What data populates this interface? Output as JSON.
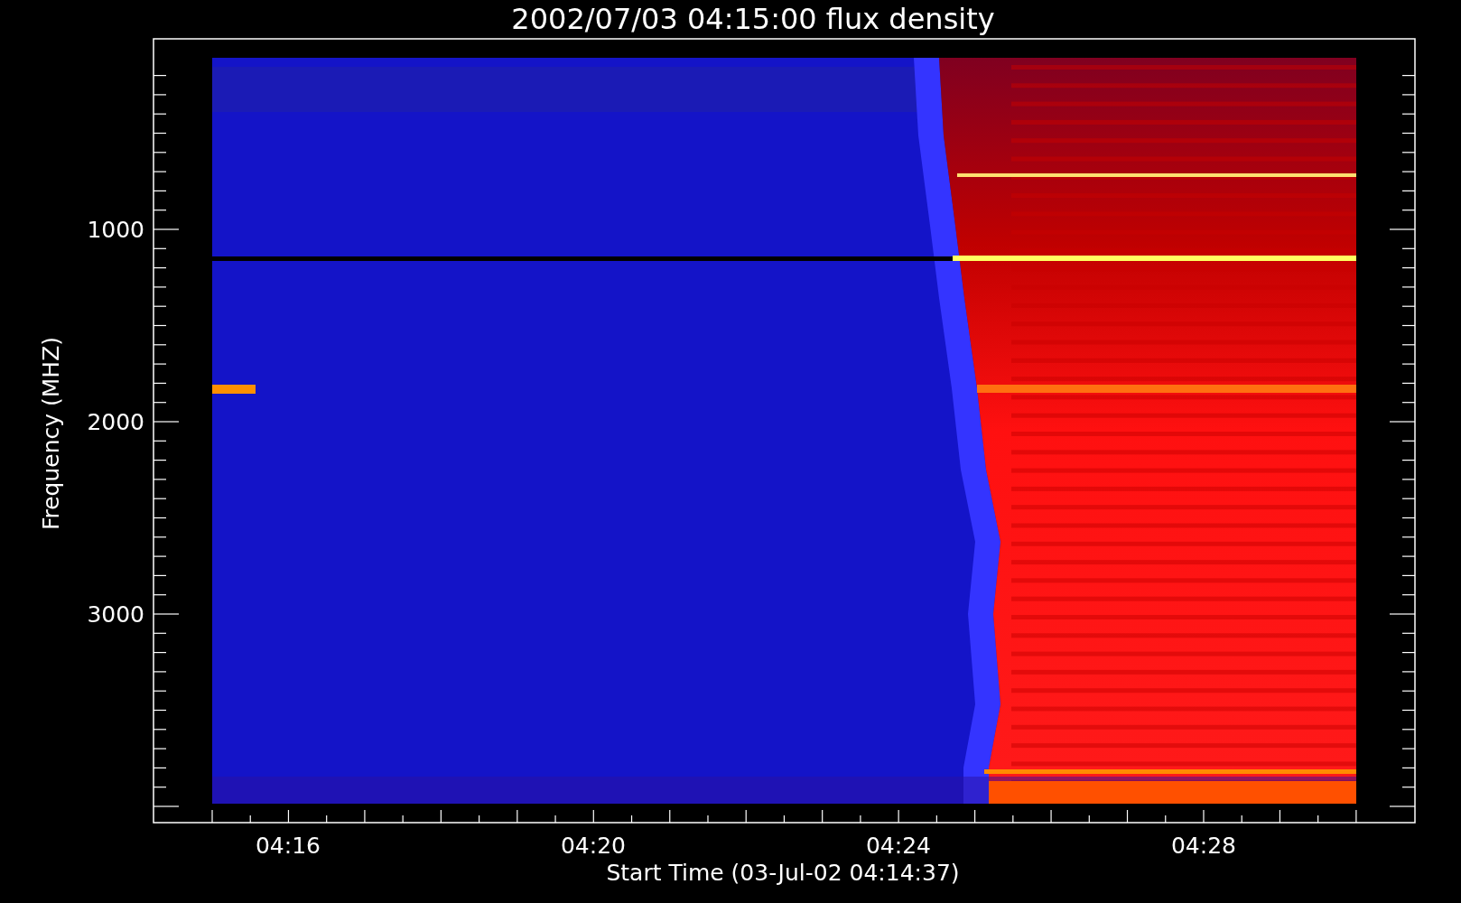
{
  "title": "2002/07/03 04:15:00 flux density",
  "y_axis": {
    "label": "Frequency (MHZ)",
    "ticks": [
      "1000",
      "2000",
      "3000"
    ]
  },
  "x_axis": {
    "label": "Start Time (03-Jul-02 04:14:37)",
    "ticks": [
      "04:16",
      "04:20",
      "04:24",
      "04:28"
    ]
  }
}
